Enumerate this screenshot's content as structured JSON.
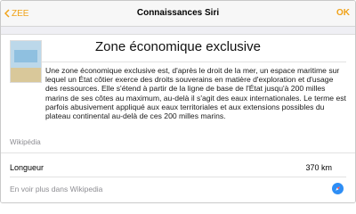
{
  "navbar": {
    "back_label": "ZEE",
    "title": "Connaissances Siri",
    "done_label": "OK",
    "accent_color": "#f0a218"
  },
  "card": {
    "title": "Zone économique exclusive",
    "description": "Une zone économique exclusive est, d'après le droit de la mer, un espace maritime sur lequel un État côtier exerce des droits souverains en matière d'exploration et d'usage des ressources. Elle s'étend à partir de la ligne de base de l'État jusqu'à 200 milles marins de ses côtes au maximum, au-delà il s'agit des eaux internationales. Le terme est parfois abusivement appliqué aux eaux territoriales et aux extensions possibles du plateau continental au-delà de ces 200 milles marins.",
    "source": "Wikipédia",
    "thumbnail_icon": "map-thumbnail"
  },
  "facts": [
    {
      "label": "Longueur",
      "value": "370 km"
    }
  ],
  "more": {
    "label": "En voir plus dans Wikipedia",
    "icon": "safari-compass-icon",
    "icon_color": "#2e8ef5"
  }
}
